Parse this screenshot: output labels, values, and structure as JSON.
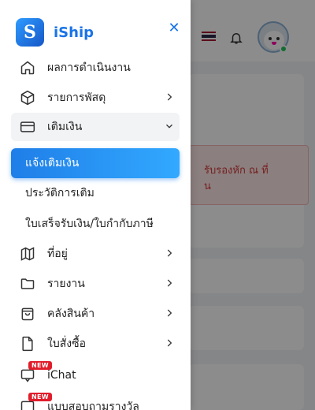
{
  "brand": {
    "name": "iShip",
    "logo_letter": "S"
  },
  "menu": [
    {
      "id": "dashboard",
      "label": "ผลการดำเนินงาน",
      "icon": "home-icon",
      "chevron": false
    },
    {
      "id": "parcels",
      "label": "รายการพัสดุ",
      "icon": "box-icon",
      "chevron": "right"
    },
    {
      "id": "topup",
      "label": "เติมเงิน",
      "icon": "credit-card-icon",
      "chevron": "down",
      "open": true
    },
    {
      "id": "address",
      "label": "ที่อยู่",
      "icon": "map-icon",
      "chevron": "right"
    },
    {
      "id": "reports",
      "label": "รายงาน",
      "icon": "folder-icon",
      "chevron": "right"
    },
    {
      "id": "warehouse",
      "label": "คลังสินค้า",
      "icon": "shopping-bag-icon",
      "chevron": "right"
    },
    {
      "id": "orders",
      "label": "ใบสั่งซื้อ",
      "icon": "file-icon",
      "chevron": "right"
    },
    {
      "id": "ichat",
      "label": "iChat",
      "icon": "chat-icon",
      "badge": "NEW"
    },
    {
      "id": "survey",
      "label": "แบบสอบถามรางวัล",
      "icon": "gift-icon",
      "badge": "NEW"
    }
  ],
  "submenu": [
    {
      "label": "แจ้งเติมเงิน",
      "active": true
    },
    {
      "label": "ประวัติการเติม",
      "active": false
    },
    {
      "label": "ใบเสร็จรับเงิน/ใบกำกับภาษี",
      "active": false
    }
  ],
  "background": {
    "alert_line1": "รับรองหัก ณ ที่",
    "alert_line2": "น"
  },
  "colors": {
    "accent": "#1a73e8",
    "active_gradient_start": "#1f7ee8",
    "active_gradient_end": "#32a9ff",
    "badge_red": "#e11d2b",
    "online_green": "#22c55e"
  }
}
